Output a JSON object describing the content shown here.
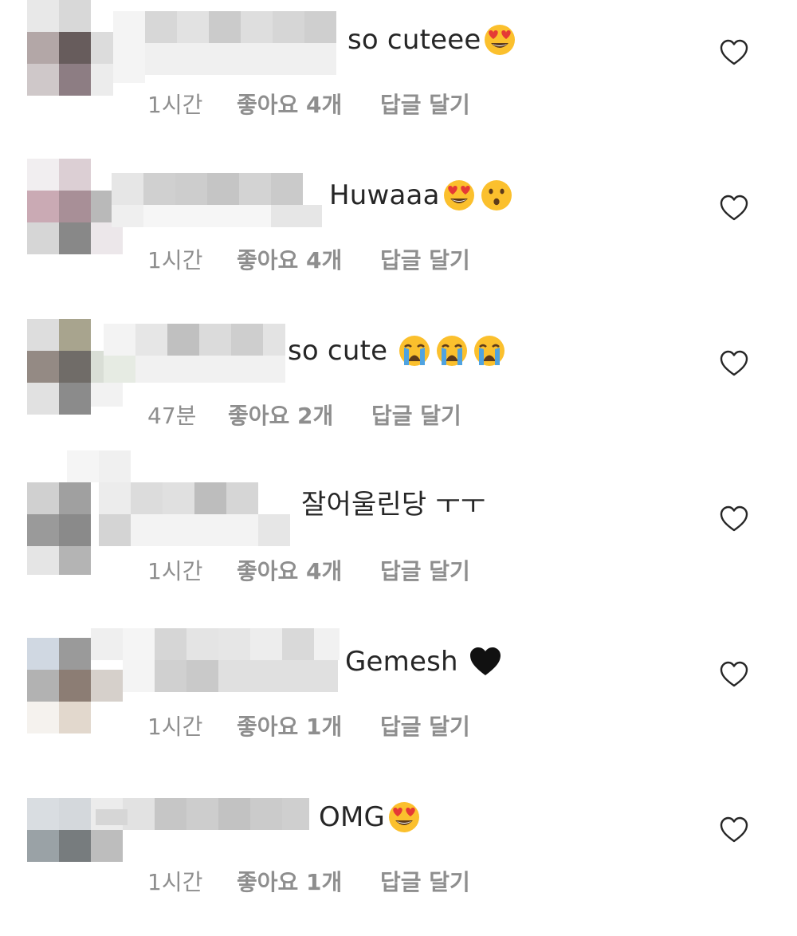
{
  "comments": [
    {
      "text": "so cuteee",
      "emojis": [
        "heart-eyes"
      ],
      "time": "1시간",
      "likes": "좋아요 4개",
      "reply": "답글 달기"
    },
    {
      "text": "Huwaaa",
      "emojis": [
        "heart-eyes",
        "hushed"
      ],
      "time": "1시간",
      "likes": "좋아요 4개",
      "reply": "답글 달기"
    },
    {
      "text": "so cute",
      "emojis": [
        "crying",
        "crying",
        "crying"
      ],
      "time": "47분",
      "likes": "좋아요 2개",
      "reply": "답글 달기"
    },
    {
      "text": "잘어울린당 ㅜㅜ",
      "emojis": [],
      "time": "1시간",
      "likes": "좋아요 4개",
      "reply": "답글 달기"
    },
    {
      "text": "Gemesh",
      "emojis": [
        "black-heart"
      ],
      "time": "1시간",
      "likes": "좋아요 1개",
      "reply": "답글 달기"
    },
    {
      "text": "OMG",
      "emojis": [
        "heart-eyes"
      ],
      "time": "1시간",
      "likes": "좋아요 1개",
      "reply": "답글 달기"
    }
  ],
  "icons": {
    "like": "heart-outline-icon"
  },
  "colors": {
    "text": "#262626",
    "meta": "#8e8e8e",
    "emoji_yellow": "#fbc02d",
    "emoji_red": "#e53935",
    "tear_blue": "#4fa3e0"
  }
}
